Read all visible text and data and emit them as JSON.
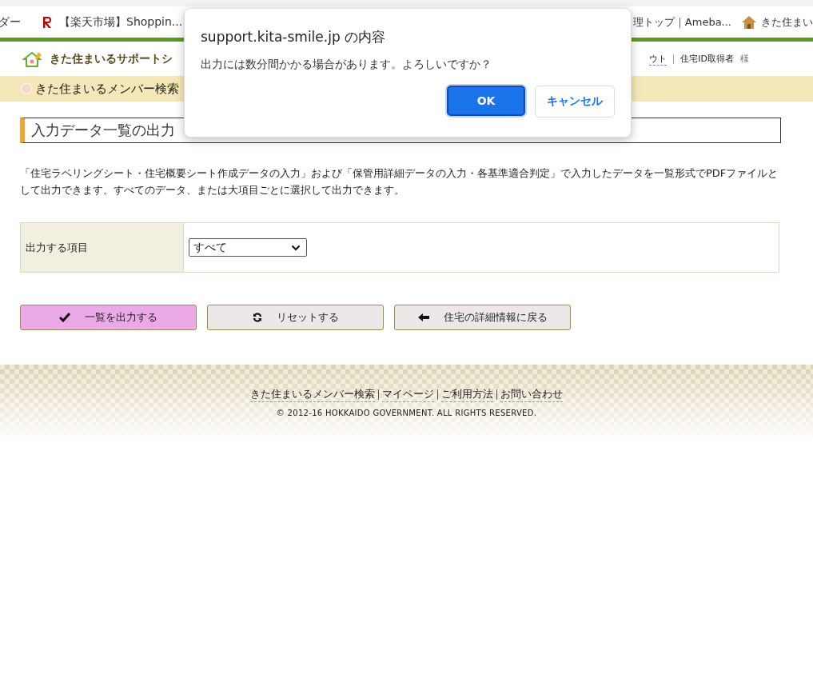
{
  "bookmarks": {
    "left": [
      {
        "label": "ダー"
      },
      {
        "label": "【楽天市場】Shoppin..."
      }
    ],
    "right": [
      {
        "label": "理トップ｜Ameba..."
      },
      {
        "label": "きた住まい"
      }
    ]
  },
  "header": {
    "site_title": "きた住まいるサポートシ",
    "links": [
      "ウト"
    ],
    "user_label": "住宅ID取得者",
    "user_suffix": "様"
  },
  "nav": {
    "item": "きた住まいるメンバー検索"
  },
  "page": {
    "heading": "入力データ一覧の出力",
    "description": "「住宅ラベリングシート・住宅概要シート作成データの入力」および「保管用詳細データの入力・各基準適合判定」で入力したデータを一覧形式でPDFファイルとして出力できます。すべてのデータ、または大項目ごとに選択して出力できます。",
    "form": {
      "label": "出力する項目",
      "value": "すべて"
    },
    "buttons": [
      {
        "label": "一覧を出力する",
        "kind": "primary"
      },
      {
        "label": "リセットする",
        "kind": "secondary"
      },
      {
        "label": "住宅の詳細情報に戻る",
        "kind": "secondary"
      }
    ]
  },
  "footer": {
    "links": [
      "きた住まいるメンバー検索",
      "マイページ",
      "ご利用方法",
      "お問い合わせ"
    ],
    "copyright": "© 2012-16 HOKKAIDO GOVERNMENT. ALL RIGHTS RESERVED."
  },
  "dialog": {
    "title": "support.kita-smile.jp の内容",
    "message": "出力には数分間かかる場合があります。よろしいですか？",
    "ok": "OK",
    "cancel": "キャンセル"
  }
}
